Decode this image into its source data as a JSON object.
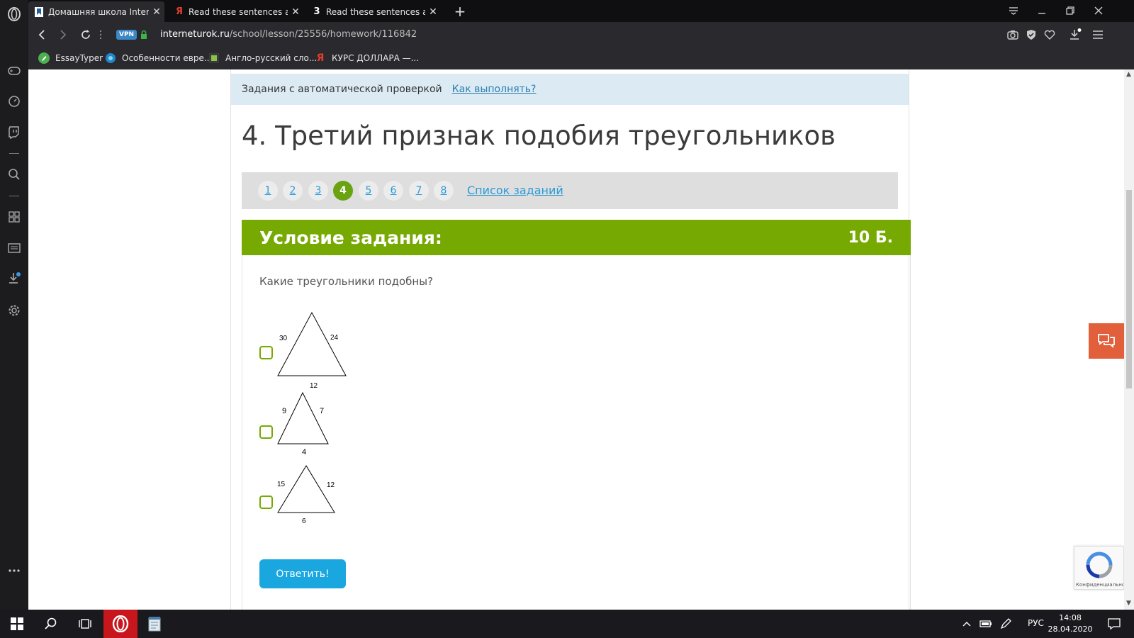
{
  "browser": {
    "tabs": [
      {
        "title": "Домашняя школа Internet",
        "favicon": "bookmark-icon",
        "active": true
      },
      {
        "title": "Read these sentences and c",
        "favicon": "yandex-icon",
        "active": false
      },
      {
        "title": "Read these sentences and f",
        "favicon": "number-3-icon",
        "active": false
      }
    ],
    "tab3_badge": "3",
    "yandex_letter": "Я",
    "url_domain": "interneturok.ru",
    "url_path": "/school/lesson/25556/homework/116842",
    "vpn_label": "VPN",
    "bookmarks": [
      {
        "label": "EssayTyper",
        "icon": "pencil-icon"
      },
      {
        "label": "Особенности евре...",
        "icon": "globe-icon"
      },
      {
        "label": "Англо-русский сло...",
        "icon": "book-icon"
      },
      {
        "label": "КУРС ДОЛЛАРА —...",
        "icon": "yandex-icon"
      }
    ]
  },
  "page": {
    "info_text": "Задания с автоматической проверкой",
    "info_link": "Как выполнять?",
    "lesson_title": "4. Третий признак подобия треугольников",
    "task_numbers": [
      "1",
      "2",
      "3",
      "4",
      "5",
      "6",
      "7",
      "8"
    ],
    "active_task": "4",
    "task_list_link": "Список заданий",
    "task_header": "Условие задания:",
    "points": "10 Б.",
    "question": "Какие треугольники подобны?",
    "options": [
      {
        "left": "30",
        "right": "24",
        "bottom": "12"
      },
      {
        "left": "9",
        "right": "7",
        "bottom": "4"
      },
      {
        "left": "15",
        "right": "12",
        "bottom": "6"
      }
    ],
    "answer_button": "Ответить!",
    "recaptcha_caption": "Конфиденциально"
  },
  "taskbar": {
    "lang": "РУС",
    "time": "14:08",
    "date": "28.04.2020"
  },
  "colors": {
    "accent_green": "#76a902",
    "link_blue": "#2a9ad6",
    "button_blue": "#1aa7e0",
    "chat_orange": "#e15f3a"
  }
}
